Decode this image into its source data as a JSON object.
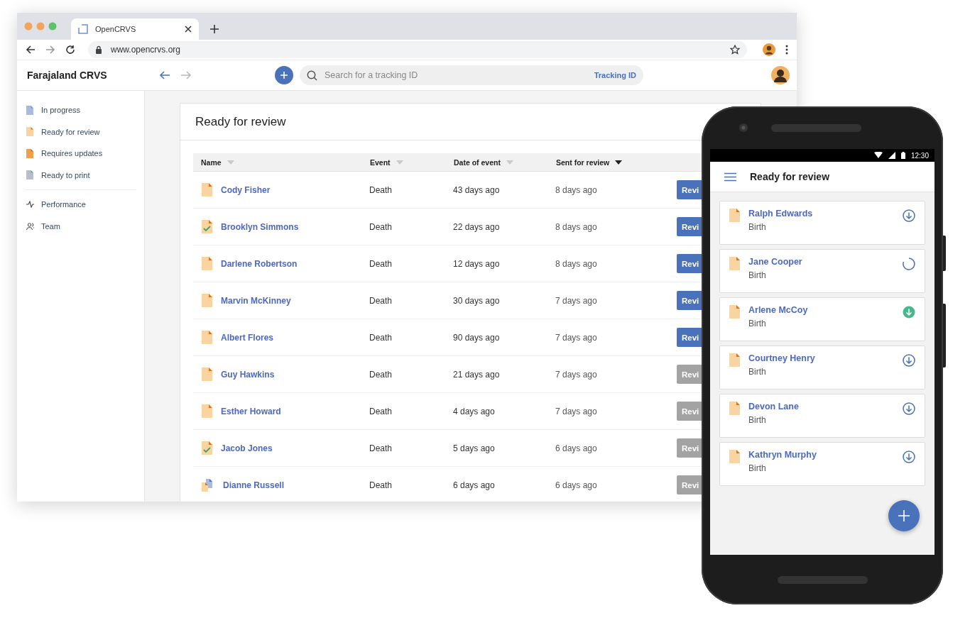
{
  "browser": {
    "tab_title": "OpenCRVS",
    "url": "www.opencrvs.org"
  },
  "app": {
    "title": "Farajaland CRVS",
    "search": {
      "placeholder": "Search for a tracking ID",
      "type_label": "Tracking ID"
    }
  },
  "sidebar": {
    "items": [
      {
        "label": "In progress",
        "kind": "progress"
      },
      {
        "label": "Ready for review",
        "kind": "review"
      },
      {
        "label": "Requires updates",
        "kind": "update"
      },
      {
        "label": "Ready to print",
        "kind": "print"
      }
    ],
    "secondary": [
      {
        "label": "Performance",
        "kind": "performance"
      },
      {
        "label": "Team",
        "kind": "team"
      }
    ]
  },
  "page": {
    "title": "Ready for review"
  },
  "table": {
    "columns": [
      {
        "label": "Name",
        "sorted": false
      },
      {
        "label": "Event",
        "sorted": false
      },
      {
        "label": "Date of event",
        "sorted": false
      },
      {
        "label": "Sent for review",
        "sorted": true
      }
    ],
    "rows": [
      {
        "name": "Cody Fisher",
        "kind": "review",
        "event": "Death",
        "date_of_event": "43 days ago",
        "sent_for_review": "8 days ago",
        "action": "Revi",
        "disabled": false
      },
      {
        "name": "Brooklyn Simmons",
        "kind": "validated",
        "event": "Death",
        "date_of_event": "22 days ago",
        "sent_for_review": "8 days ago",
        "action": "Revi",
        "disabled": false
      },
      {
        "name": "Darlene Robertson",
        "kind": "review",
        "event": "Death",
        "date_of_event": "12 days ago",
        "sent_for_review": "8 days ago",
        "action": "Revi",
        "disabled": false
      },
      {
        "name": "Marvin McKinney",
        "kind": "review",
        "event": "Death",
        "date_of_event": "30 days ago",
        "sent_for_review": "7 days ago",
        "action": "Revi",
        "disabled": false
      },
      {
        "name": "Albert Flores",
        "kind": "review",
        "event": "Death",
        "date_of_event": "90 days ago",
        "sent_for_review": "7 days ago",
        "action": "Revi",
        "disabled": false
      },
      {
        "name": "Guy Hawkins",
        "kind": "review",
        "event": "Death",
        "date_of_event": "21 days ago",
        "sent_for_review": "7 days ago",
        "action": "Revi",
        "disabled": true
      },
      {
        "name": "Esther Howard",
        "kind": "review",
        "event": "Death",
        "date_of_event": "4 days ago",
        "sent_for_review": "7 days ago",
        "action": "Revi",
        "disabled": true
      },
      {
        "name": "Jacob Jones",
        "kind": "validated",
        "event": "Death",
        "date_of_event": "5 days ago",
        "sent_for_review": "6 days ago",
        "action": "Revi",
        "disabled": true
      },
      {
        "name": "Dianne Russell",
        "kind": "multiple",
        "event": "Death",
        "date_of_event": "6 days ago",
        "sent_for_review": "6 days ago",
        "action": "Revi",
        "disabled": true
      }
    ]
  },
  "phone": {
    "time": "12:30",
    "title": "Ready for review",
    "cards": [
      {
        "name": "Ralph Edwards",
        "event": "Birth",
        "kind": "download"
      },
      {
        "name": "Jane Cooper",
        "event": "Birth",
        "kind": "loading"
      },
      {
        "name": "Arlene McCoy",
        "event": "Birth",
        "kind": "downloaded"
      },
      {
        "name": "Courtney Henry",
        "event": "Birth",
        "kind": "download"
      },
      {
        "name": "Devon Lane",
        "event": "Birth",
        "kind": "download"
      },
      {
        "name": "Kathryn Murphy",
        "event": "Birth",
        "kind": "download"
      }
    ]
  }
}
